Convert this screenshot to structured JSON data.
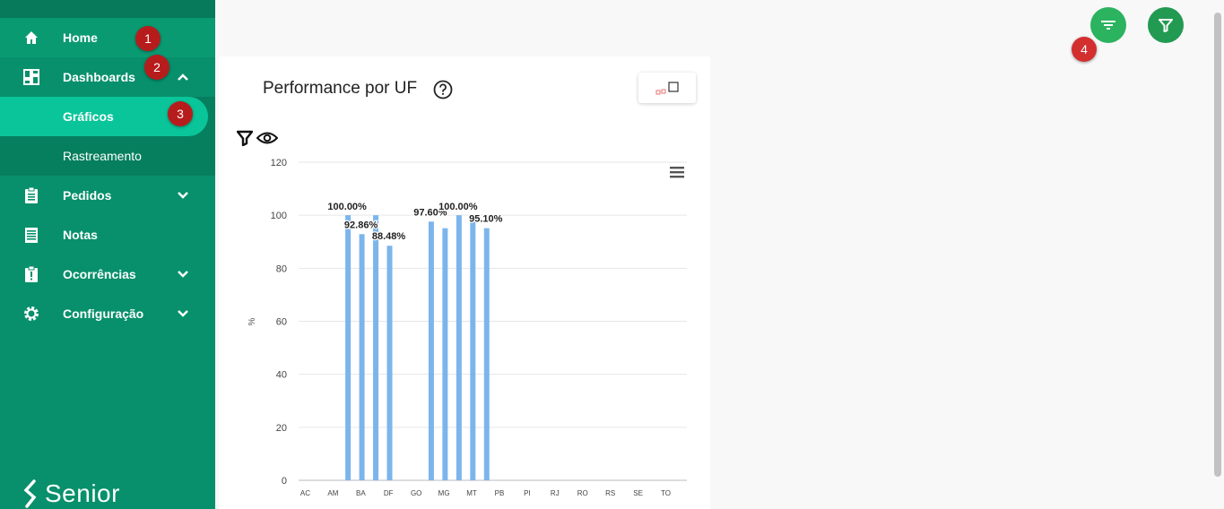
{
  "sidebar": {
    "items": [
      {
        "label": "Home"
      },
      {
        "label": "Dashboards"
      },
      {
        "label": "Gráficos"
      },
      {
        "label": "Rastreamento"
      },
      {
        "label": "Pedidos"
      },
      {
        "label": "Notas"
      },
      {
        "label": "Ocorrências"
      },
      {
        "label": "Configuração"
      }
    ],
    "logo_text": "Senior"
  },
  "badges": [
    "1",
    "2",
    "3",
    "4"
  ],
  "colors": {
    "sidebar_bg": "#07906b",
    "active_item": "#0ac59a",
    "fab_green": "#27a45a",
    "bar_color": "#7cb5ec",
    "badge_red": "#b71c1c"
  },
  "card": {
    "title": "Performance por UF"
  },
  "chart_data": {
    "type": "bar",
    "title": "Performance por UF",
    "ylabel": "%",
    "xlabel": "",
    "ylim": [
      0,
      120
    ],
    "yticks": [
      0,
      20,
      40,
      60,
      80,
      100,
      120
    ],
    "categories": [
      "AC",
      "AM",
      "BA",
      "DF",
      "GO",
      "MG",
      "MT",
      "PB",
      "PI",
      "RJ",
      "RO",
      "RS",
      "SE",
      "TO"
    ],
    "series": [
      {
        "values": [
          null,
          null,
          null,
          100,
          92.86,
          100,
          88.48,
          null,
          null,
          97.6,
          95.1,
          100,
          100,
          95.1
        ]
      }
    ],
    "data_labels": [
      {
        "text": "100.00%",
        "value": 100
      },
      {
        "text": "92.86%",
        "value": 92.86
      },
      {
        "text": "88.48%",
        "value": 88.48
      },
      {
        "text": "97.60%",
        "value": 97.6
      },
      {
        "text": "100.00%",
        "value": 100
      },
      {
        "text": "95.10%",
        "value": 95.1
      }
    ],
    "grid": true
  }
}
